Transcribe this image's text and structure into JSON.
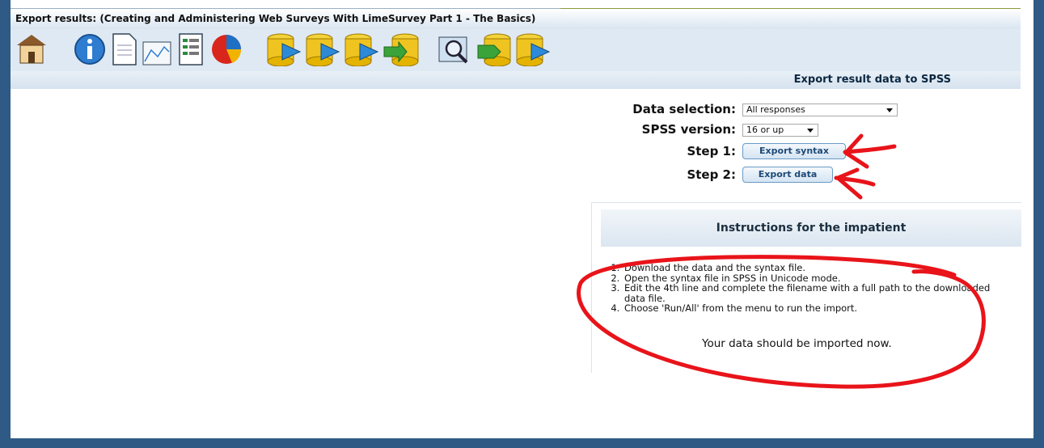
{
  "window": {
    "title": "Export results: (Creating and Administering Web Surveys With LimeSurvey Part 1 - The Basics)"
  },
  "toolbar": {
    "icons": [
      "home-icon",
      "info-icon",
      "document-icon",
      "chart-icon",
      "list-icon",
      "pie-chart-icon",
      "export-icon",
      "export-spss-icon",
      "export-r-icon",
      "import-icon",
      "browse-icon",
      "vv-export-icon",
      "vv-import-icon"
    ]
  },
  "section": {
    "heading": "Export result data to SPSS"
  },
  "form": {
    "data_selection_label": "Data selection:",
    "data_selection_value": "All responses",
    "spss_version_label": "SPSS version:",
    "spss_version_value": "16 or up",
    "step1_label": "Step 1:",
    "step1_button": "Export syntax",
    "step2_label": "Step 2:",
    "step2_button": "Export data"
  },
  "instructions": {
    "heading": "Instructions for the impatient",
    "steps": [
      "Download the data and the syntax file.",
      "Open the syntax file in SPSS in Unicode mode.",
      "Edit the 4th line and complete the filename with a full path to the downloaded data file.",
      "Choose 'Run/All' from the menu to run the import."
    ],
    "final": "Your data should be imported now."
  },
  "colors": {
    "frame": "#2f5a86",
    "annotation": "#e8141a",
    "button_text": "#1d4a78"
  }
}
